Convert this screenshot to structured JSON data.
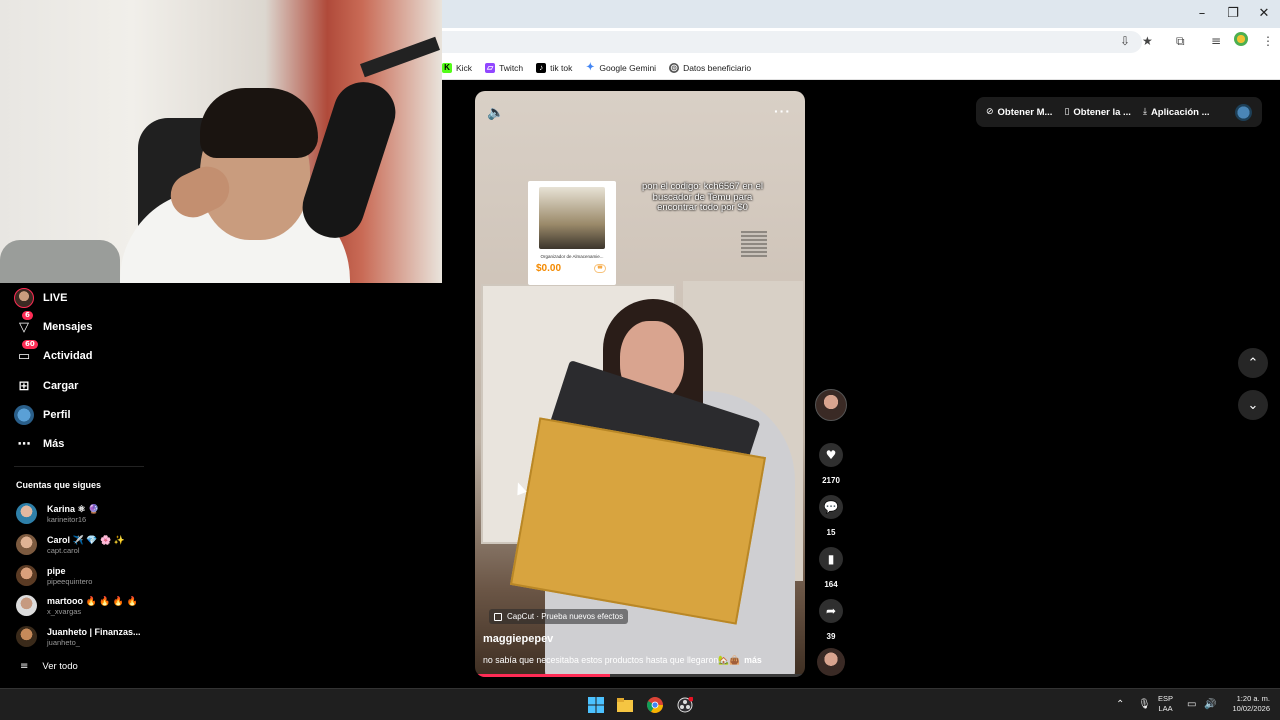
{
  "browser": {
    "bookmarks": [
      {
        "label": "Kick",
        "icon": "kick-icon",
        "color": "#53fc18"
      },
      {
        "label": "Twitch",
        "icon": "twitch-icon",
        "color": "#9146ff"
      },
      {
        "label": "tik tok",
        "icon": "tiktok-icon",
        "color": "#000000"
      },
      {
        "label": "Google Gemini",
        "icon": "gemini-icon",
        "color": "#4285f4"
      },
      {
        "label": "Datos beneficiario",
        "icon": "globe-icon",
        "color": "#555555"
      }
    ]
  },
  "sidebar": {
    "nav": [
      {
        "label": "LIVE",
        "icon": "live-avatar-icon",
        "badge": ""
      },
      {
        "label": "Mensajes",
        "icon": "messages-icon",
        "badge": "6"
      },
      {
        "label": "Actividad",
        "icon": "activity-icon",
        "badge": "60"
      },
      {
        "label": "Cargar",
        "icon": "upload-icon",
        "badge": ""
      },
      {
        "label": "Perfil",
        "icon": "profile-icon",
        "badge": ""
      },
      {
        "label": "Más",
        "icon": "more-icon",
        "badge": ""
      }
    ],
    "following_title": "Cuentas que sigues",
    "following": [
      {
        "name": "Karina",
        "emoji": "⚛ 🔮",
        "handle": "karineitor16",
        "color": "#3a8fb7"
      },
      {
        "name": "Carol",
        "emoji": "✈️ 💎 🌸 ✨",
        "handle": "capt.carol",
        "color": "#c9a37c"
      },
      {
        "name": "pipe",
        "emoji": "",
        "handle": "pipeequintero",
        "color": "#b89274"
      },
      {
        "name": "martooo",
        "emoji": "🔥 🔥 🔥 🔥",
        "handle": "x_xvargas",
        "color": "#d6d6d6"
      },
      {
        "name": "Juanheto | Finanzas...",
        "emoji": "",
        "handle": "juanheto_",
        "color": "#c68a5a"
      }
    ],
    "see_all": "Ver todo"
  },
  "video": {
    "product_name": "Organizador de Almacenamie...",
    "product_price": "$0.00",
    "overlay_text": "pon el codigo: kch6567 en el buscador de Temu para encontrar todo por $0",
    "effect": "CapCut · Prueba nuevos efectos",
    "username": "maggiepepev",
    "description": "no sabía que necesitaba estos productos hasta que llegaron🏡👜",
    "more": "más",
    "progress": 0.41
  },
  "actions": {
    "likes": "2170",
    "comments": "15",
    "saves": "164",
    "shares": "39"
  },
  "topbar": {
    "items": [
      {
        "label": "Obtener M...",
        "icon": "coin-icon"
      },
      {
        "label": "Obtener la ...",
        "icon": "phone-icon"
      },
      {
        "label": "Aplicación ...",
        "icon": "download-icon"
      }
    ]
  },
  "taskbar": {
    "lang_top": "ESP",
    "lang_bottom": "LAA",
    "time": "1:20 a. m.",
    "date": "10/02/2026"
  }
}
